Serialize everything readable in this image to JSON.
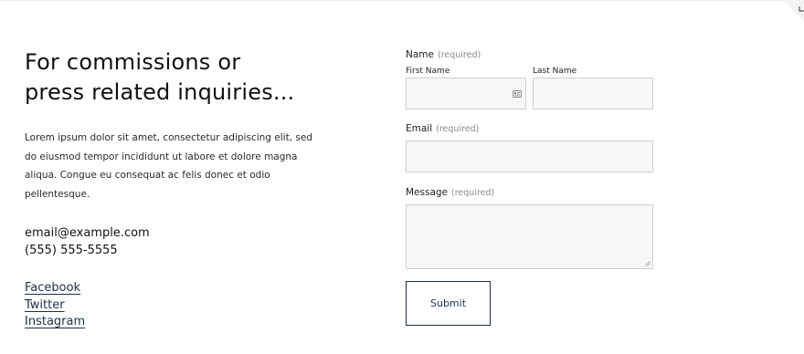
{
  "info": {
    "heading_line1": "For commissions or",
    "heading_line2": "press related inquiries...",
    "intro": "Lorem ipsum dolor sit amet, consectetur adipiscing elit, sed do eiusmod tempor incididunt ut labore et dolore magna aliqua. Congue eu consequat ac felis donec et odio pellentesque.",
    "email": "email@example.com",
    "phone": "(555) 555-5555",
    "social": [
      "Facebook",
      "Twitter",
      "Instagram"
    ]
  },
  "form": {
    "name_label": "Name",
    "required_text": "(required)",
    "first_name_label": "First Name",
    "last_name_label": "Last Name",
    "email_label": "Email",
    "message_label": "Message",
    "submit_label": "Submit"
  },
  "icons": {
    "autofill": "contact-card-icon",
    "resize": "resize-grip-icon"
  },
  "colors": {
    "accent": "#1f2f4a",
    "input_bg": "#f7f7f7",
    "input_border": "#cfcfcf",
    "muted_text": "#8a8a8a"
  }
}
